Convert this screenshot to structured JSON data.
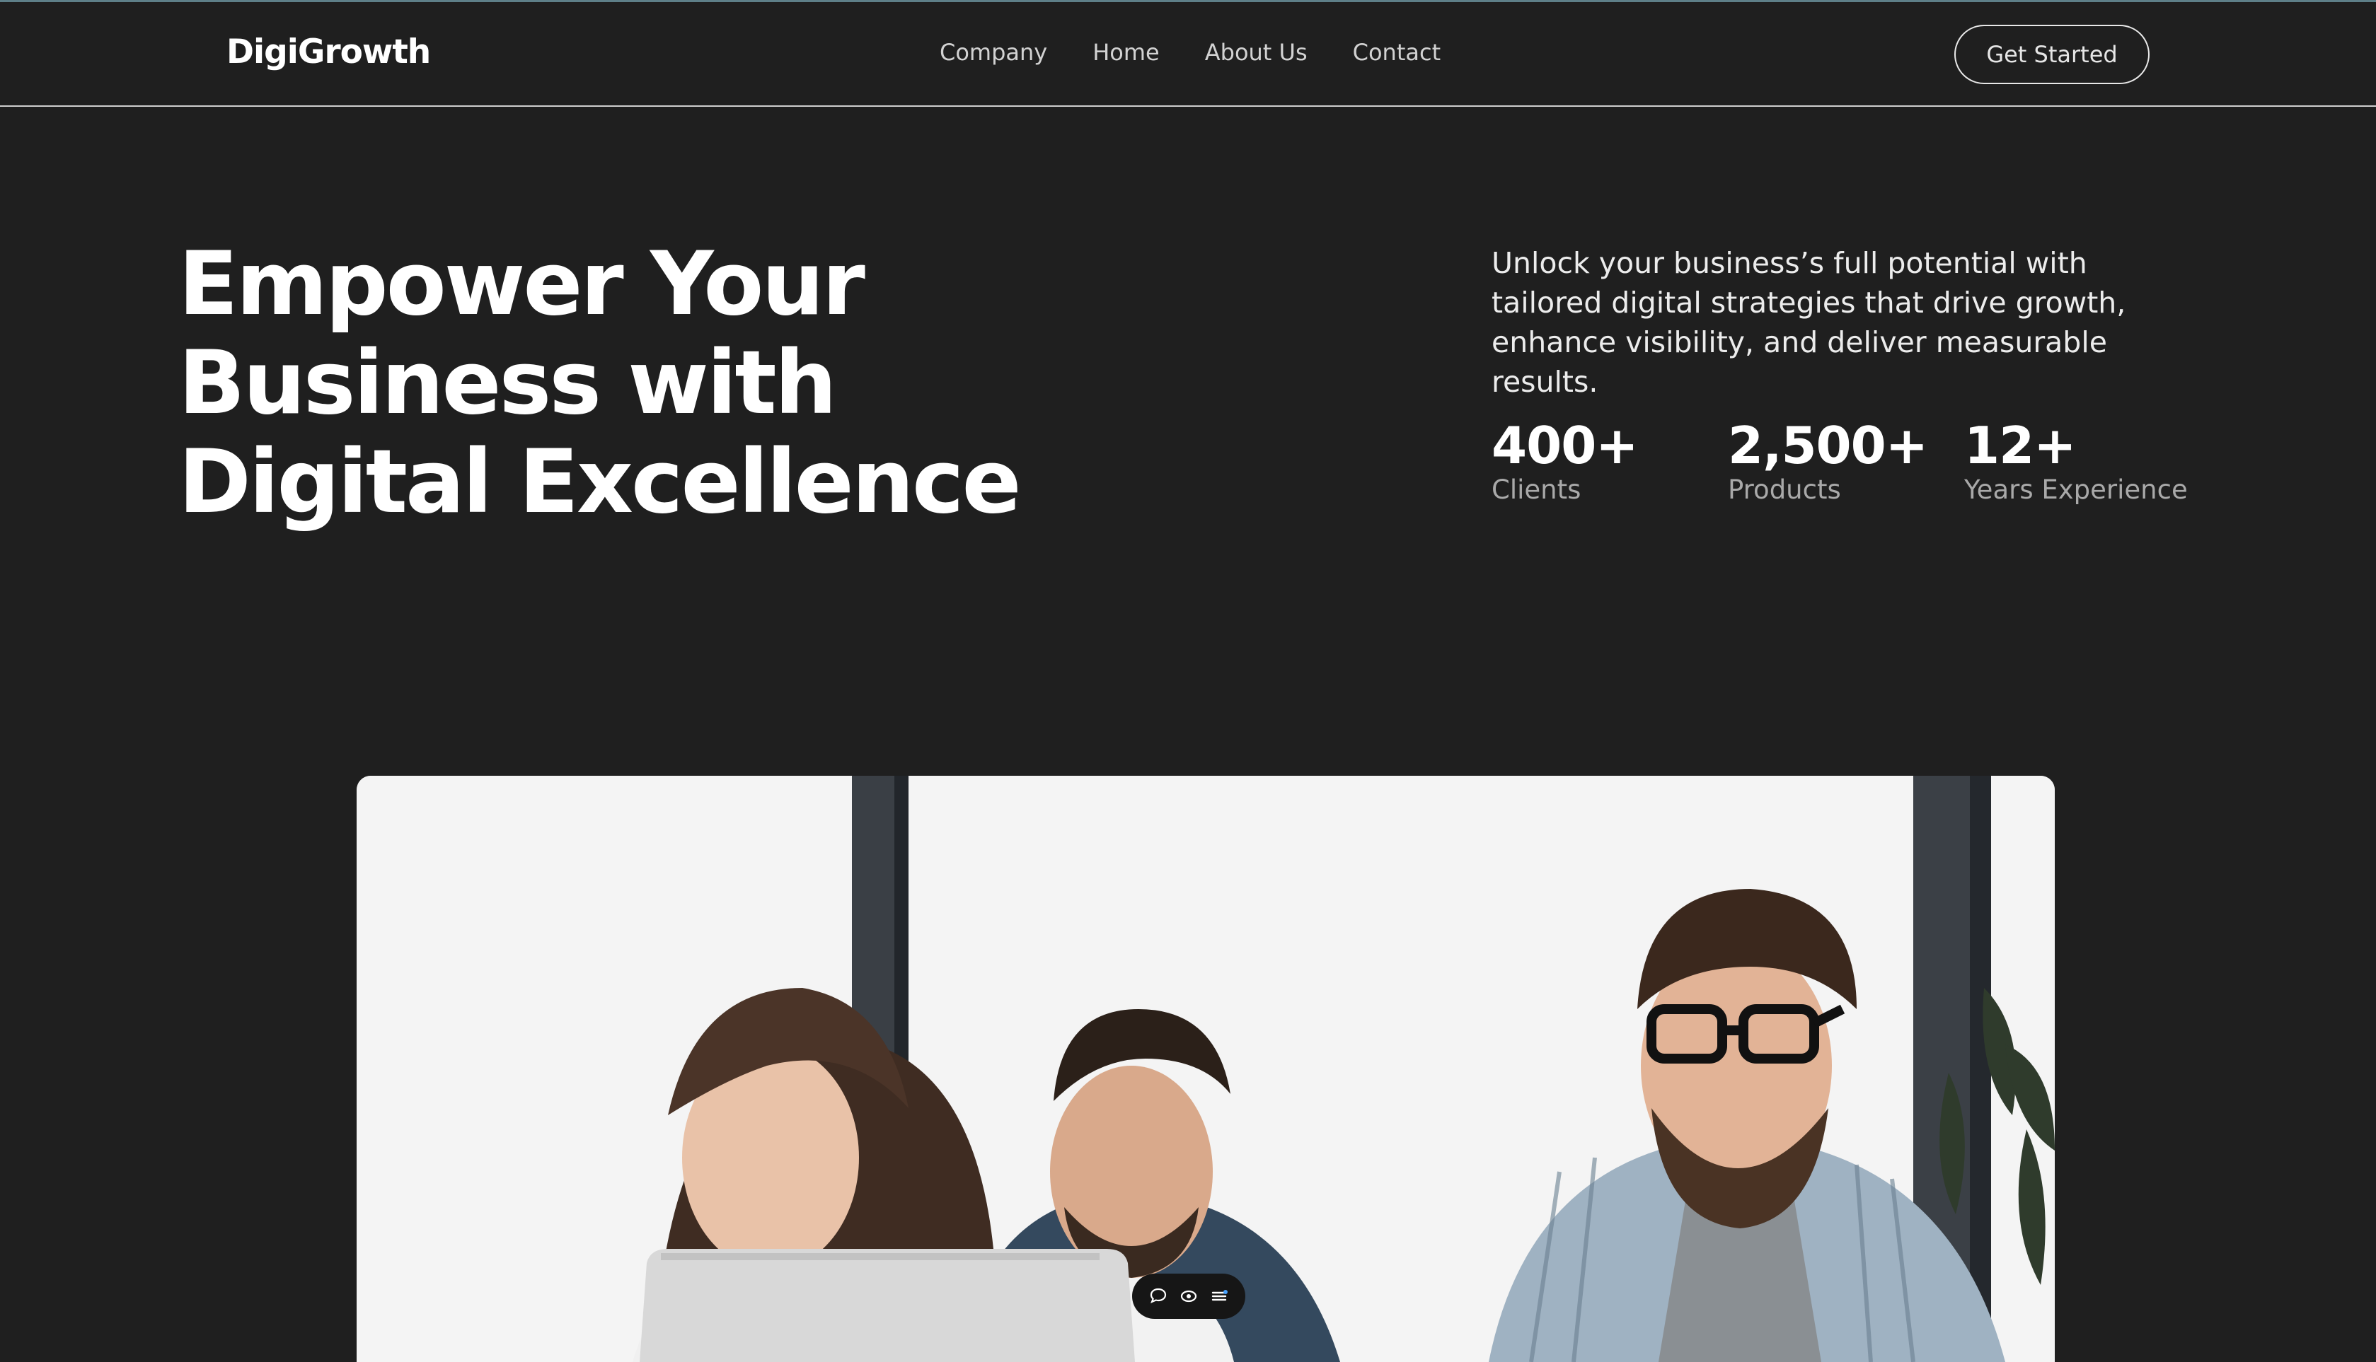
{
  "nav": {
    "logo": "DigiGrowth",
    "links": [
      "Company",
      "Home",
      "About Us",
      "Contact"
    ],
    "cta": "Get Started"
  },
  "hero": {
    "title": "Empower Your Business with Digital Excellence",
    "description": "Unlock your business’s full potential with tailored digital strategies that drive growth, enhance visibility, and deliver measurable results.",
    "stats": [
      {
        "value": "400+",
        "label": "Clients"
      },
      {
        "value": "2,500+",
        "label": "Products"
      },
      {
        "value": "12+",
        "label": "Years Experience"
      }
    ]
  },
  "toolbar": {
    "icons": [
      "comment-icon",
      "eye-icon",
      "menu-icon"
    ]
  },
  "colors": {
    "background": "#1f1f1f",
    "text": "#ffffff",
    "muted": "#a9a9a9",
    "accent_line": "#5e7f88"
  }
}
